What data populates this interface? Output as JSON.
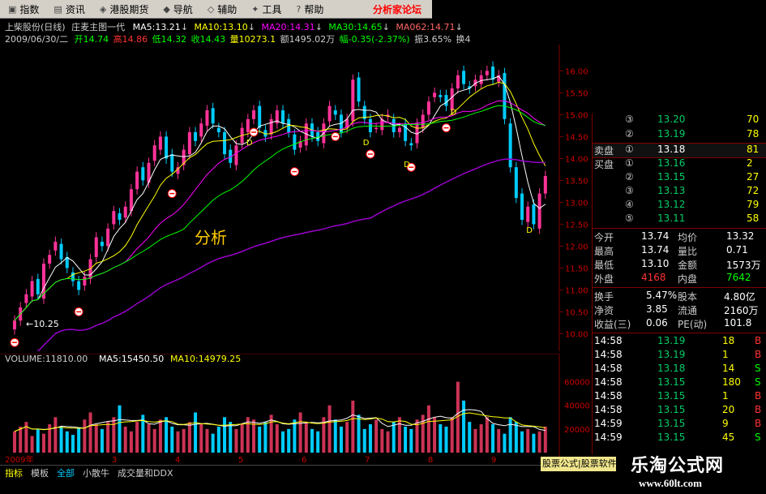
{
  "menu": {
    "items": [
      {
        "label": "指数",
        "icon": "index-icon"
      },
      {
        "label": "资讯",
        "icon": "news-icon"
      },
      {
        "label": "港股期货",
        "icon": "futures-icon"
      },
      {
        "label": "导航",
        "icon": "navigate-icon"
      },
      {
        "label": "辅助",
        "icon": "assist-icon"
      },
      {
        "label": "工具",
        "icon": "tools-icon"
      },
      {
        "label": "帮助",
        "icon": "help-icon"
      }
    ],
    "forum_title": "分析家论坛"
  },
  "header": {
    "stock": "上柴股份(日线)",
    "formula": "庄麦主图一代",
    "ma5": "MA5:13.21",
    "ma10": "MA10:13.10",
    "ma20": "MA20:14.31",
    "ma30": "MA30:14.65",
    "ma62": "MA062:14.71",
    "date": "2009/06/30/二",
    "open": "开14.74",
    "high": "高14.86",
    "low": "低14.32",
    "close": "收14.43",
    "volume": "量10273.1",
    "amount": "额1495.02万",
    "change": "幅-0.35(-2.37%)",
    "amplitude": "振3.65%",
    "turnover": "换4"
  },
  "chart_data": {
    "type": "line",
    "title": "上柴股份(日线)",
    "y_ticks": [
      "16.00",
      "15.50",
      "15.00",
      "14.50",
      "14.00",
      "13.50",
      "13.00",
      "12.50",
      "12.00",
      "11.50",
      "11.00",
      "10.50",
      "10.00"
    ],
    "ylim": [
      9.6,
      16.6
    ],
    "volume_ticks": [
      "60000",
      "40000",
      "20000"
    ],
    "x_labels": [
      "2009年",
      "3",
      "4",
      "5",
      "6",
      "7",
      "8",
      "9"
    ],
    "annotations": {
      "low_marker": "←10.25",
      "watermark": "分析",
      "d_markers": [
        "D",
        "D",
        "D",
        "D",
        "D"
      ]
    },
    "volume_header": {
      "volume": "VOLUME:11810.00",
      "ma5": "MA5:15450.50",
      "ma10": "MA10:14979.25"
    },
    "series_price": [
      10.3,
      10.6,
      10.9,
      11.2,
      10.9,
      11.6,
      11.8,
      12.1,
      11.7,
      11.5,
      11.2,
      11.0,
      11.3,
      11.7,
      12.2,
      12.0,
      12.4,
      12.8,
      12.6,
      12.9,
      13.3,
      13.7,
      13.5,
      13.9,
      14.3,
      14.5,
      14.0,
      13.7,
      13.8,
      14.2,
      14.6,
      14.4,
      14.8,
      15.1,
      14.8,
      14.6,
      14.1,
      13.9,
      14.3,
      14.7,
      14.9,
      15.1,
      14.7,
      14.5,
      14.9,
      15.1,
      14.8,
      14.6,
      14.2,
      14.4,
      14.8,
      14.5,
      14.4,
      14.8,
      15.2,
      15.0,
      14.6,
      14.9,
      15.8,
      15.3,
      14.9,
      14.6,
      14.7,
      14.9,
      15.0,
      14.6,
      14.7,
      14.4,
      14.3,
      14.8,
      15.0,
      15.3,
      15.5,
      15.4,
      15.2,
      15.6,
      15.9,
      15.7,
      15.6,
      15.8,
      15.9,
      16.0,
      15.8,
      15.9,
      14.9,
      13.8,
      13.1,
      12.6,
      12.9,
      12.5,
      13.2,
      13.6
    ],
    "volume_values": [
      18,
      22,
      26,
      14,
      20,
      16,
      24,
      30,
      22,
      18,
      15,
      21,
      28,
      34,
      24,
      20,
      26,
      30,
      40,
      22,
      18,
      26,
      32,
      24,
      20,
      28,
      30,
      22,
      18,
      20,
      26,
      34,
      24,
      20,
      16,
      22,
      30,
      26,
      20,
      24,
      30,
      28,
      22,
      26,
      32,
      24,
      18,
      20,
      28,
      34,
      26,
      20,
      18,
      30,
      40,
      28,
      22,
      26,
      44,
      32,
      20,
      24,
      28,
      20,
      18,
      26,
      30,
      22,
      20,
      28,
      32,
      40,
      30,
      24,
      22,
      30,
      60,
      44,
      26,
      20,
      24,
      30,
      24,
      20,
      16,
      30,
      26,
      18,
      20,
      16,
      18,
      22
    ]
  },
  "quote": {
    "sell": [
      {
        "idx": "③",
        "price": "13.20",
        "vol": "70"
      },
      {
        "idx": "②",
        "price": "13.19",
        "vol": "78"
      },
      {
        "idx": "①",
        "price": "13.18",
        "vol": "81",
        "label": "卖盘"
      }
    ],
    "buy": [
      {
        "idx": "①",
        "price": "13.16",
        "vol": "2",
        "label": "买盘"
      },
      {
        "idx": "②",
        "price": "13.15",
        "vol": "27"
      },
      {
        "idx": "③",
        "price": "13.13",
        "vol": "72"
      },
      {
        "idx": "④",
        "price": "13.12",
        "vol": "79"
      },
      {
        "idx": "⑤",
        "price": "13.11",
        "vol": "58"
      }
    ],
    "stats": [
      {
        "l1": "今开",
        "v1": "13.74",
        "l2": "均价",
        "v2": "13.32"
      },
      {
        "l1": "最高",
        "v1": "13.74",
        "l2": "量比",
        "v2": "0.71"
      },
      {
        "l1": "最低",
        "v1": "13.10",
        "l2": "金额",
        "v2": "1573万"
      },
      {
        "l1": "外盘",
        "v1": "4168",
        "l2": "内盘",
        "v2": "7642"
      }
    ],
    "stats2": [
      {
        "l1": "换手",
        "v1": "5.47%",
        "l2": "股本",
        "v2": "4.80亿"
      },
      {
        "l1": "净资",
        "v1": "3.85",
        "l2": "流通",
        "v2": "2160万"
      },
      {
        "l1": "收益(三)",
        "v1": "0.06",
        "l2": "PE(动)",
        "v2": "101.8"
      }
    ],
    "ticks": [
      {
        "time": "14:58",
        "price": "13.19",
        "vol": "18",
        "side": "B"
      },
      {
        "time": "14:58",
        "price": "13.19",
        "vol": "1",
        "side": "B"
      },
      {
        "time": "14:58",
        "price": "13.18",
        "vol": "14",
        "side": "S"
      },
      {
        "time": "14:58",
        "price": "13.15",
        "vol": "180",
        "side": "S"
      },
      {
        "time": "14:58",
        "price": "13.15",
        "vol": "1",
        "side": "B"
      },
      {
        "time": "14:58",
        "price": "13.15",
        "vol": "20",
        "side": "B"
      },
      {
        "time": "14:59",
        "price": "13.15",
        "vol": "9",
        "side": "B"
      },
      {
        "time": "14:59",
        "price": "13.15",
        "vol": "45",
        "side": "S"
      }
    ]
  },
  "bottom_tabs": [
    "指标",
    "模板",
    "全部",
    "小散牛",
    "成交量和DDX"
  ],
  "software_tag": "股票公式|股票软件",
  "brand": {
    "name": "乐淘公式网",
    "url": "www.60lt.com"
  },
  "colors": {
    "up": "#ff3399",
    "down": "#00ccff",
    "ma5": "#ffffff",
    "ma10": "#ffff00",
    "ma20": "#ff00ff",
    "ma30": "#00ff00",
    "ma62": "#ff6666",
    "trend": "#9900cc"
  }
}
